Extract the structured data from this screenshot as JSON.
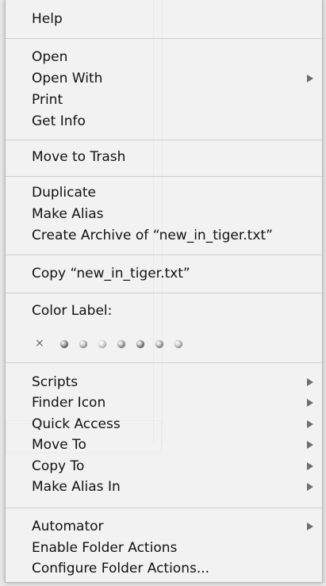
{
  "menu": {
    "sections": [
      {
        "items": [
          {
            "label": "Help",
            "submenu": false
          }
        ]
      },
      {
        "items": [
          {
            "label": "Open",
            "submenu": false
          },
          {
            "label": "Open With",
            "submenu": true
          },
          {
            "label": "Print",
            "submenu": false
          },
          {
            "label": "Get Info",
            "submenu": false
          }
        ]
      },
      {
        "items": [
          {
            "label": "Move to Trash",
            "submenu": false
          }
        ]
      },
      {
        "items": [
          {
            "label": "Duplicate",
            "submenu": false
          },
          {
            "label": "Make Alias",
            "submenu": false
          },
          {
            "label": "Create Archive of “new_in_tiger.txt”",
            "submenu": false
          }
        ]
      },
      {
        "items": [
          {
            "label": "Copy “new_in_tiger.txt”",
            "submenu": false
          }
        ]
      },
      {
        "color_label": {
          "title": "Color Label:",
          "no_color_glyph": "×",
          "colors": [
            "#777777",
            "#b1b1b1",
            "#d2d2d2",
            "#9a9a9a",
            "#808080",
            "#9d9d9d",
            "#b7b7b7"
          ]
        }
      },
      {
        "items": [
          {
            "label": "Scripts",
            "submenu": true
          },
          {
            "label": "Finder Icon",
            "submenu": true
          },
          {
            "label": "Quick Access",
            "submenu": true
          },
          {
            "label": "Move To",
            "submenu": true
          },
          {
            "label": "Copy To",
            "submenu": true
          },
          {
            "label": "Make Alias In",
            "submenu": true
          }
        ]
      },
      {
        "items": [
          {
            "label": "Automator",
            "submenu": true
          },
          {
            "label": "Enable Folder Actions",
            "submenu": false
          },
          {
            "label": "Configure Folder Actions...",
            "submenu": false
          }
        ]
      }
    ]
  },
  "colors": {
    "menu_background": "#f2f2f2",
    "separator": "#cdcdcd",
    "text": "#111111",
    "submenu_arrow": "#6e6e6e"
  }
}
